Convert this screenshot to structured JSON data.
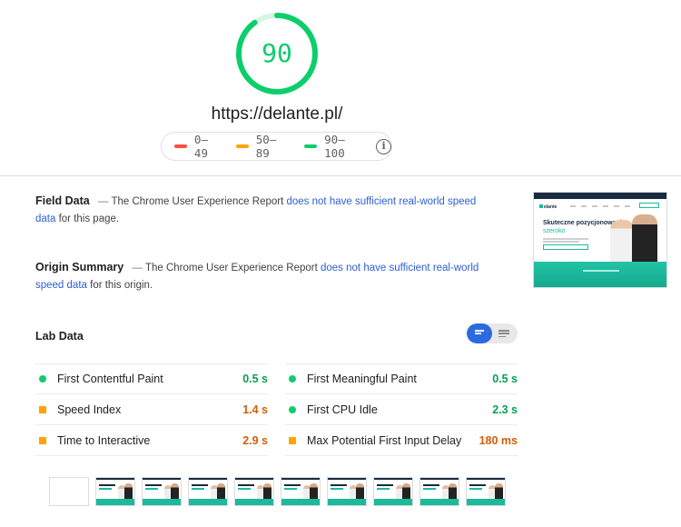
{
  "score": {
    "value": "90",
    "fraction": 0.9,
    "color": "#0cce6b",
    "track_color": "#d7f5e5"
  },
  "url": "https://delante.pl/",
  "legend": {
    "items": [
      {
        "label": "0–49",
        "color": "#ff4e42"
      },
      {
        "label": "50–89",
        "color": "#ffa400"
      },
      {
        "label": "90–100",
        "color": "#0cce6b"
      }
    ],
    "info_icon": "info-icon"
  },
  "field_data": {
    "title": "Field Data",
    "dash": "—",
    "text_before": "The Chrome User Experience Report",
    "link": "does not have sufficient real-world speed data",
    "text_after": "for this page."
  },
  "origin_summary": {
    "title": "Origin Summary",
    "dash": "—",
    "text_before": "The Chrome User Experience Report",
    "link": "does not have sufficient real-world speed data",
    "text_after": "for this origin."
  },
  "final_screenshot": {
    "logo": "elante",
    "headline": "Skuteczne pozycjonowanie",
    "headline_accent": "szeroko"
  },
  "lab_data": {
    "title": "Lab Data",
    "metrics_left": [
      {
        "label": "First Contentful Paint",
        "value": "0.5 s",
        "status": "pass"
      },
      {
        "label": "Speed Index",
        "value": "1.4 s",
        "status": "average"
      },
      {
        "label": "Time to Interactive",
        "value": "2.9 s",
        "status": "average"
      }
    ],
    "metrics_right": [
      {
        "label": "First Meaningful Paint",
        "value": "0.5 s",
        "status": "pass"
      },
      {
        "label": "First CPU Idle",
        "value": "2.3 s",
        "status": "pass"
      },
      {
        "label": "Max Potential First Input Delay",
        "value": "180 ms",
        "status": "average"
      }
    ],
    "toggle": {
      "selected": "compact",
      "options": [
        "compact",
        "expanded"
      ]
    }
  },
  "filmstrip": {
    "frames": [
      {
        "state": "blank"
      },
      {
        "state": "loaded"
      },
      {
        "state": "loaded"
      },
      {
        "state": "loaded"
      },
      {
        "state": "loaded"
      },
      {
        "state": "loaded"
      },
      {
        "state": "loaded"
      },
      {
        "state": "loaded"
      },
      {
        "state": "loaded"
      },
      {
        "state": "loaded"
      }
    ]
  }
}
